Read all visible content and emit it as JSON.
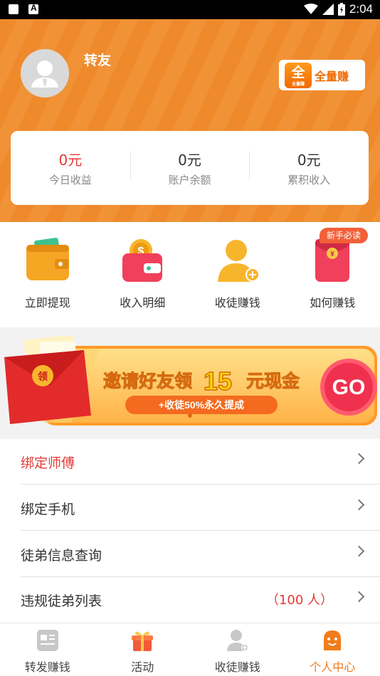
{
  "status_bar": {
    "time": "2:04"
  },
  "profile": {
    "username": "转友"
  },
  "brand_button": {
    "logo_char": "全",
    "logo_sub": "全量赚",
    "label": "全量赚"
  },
  "earnings": [
    {
      "value": "0元",
      "label": "今日收益",
      "highlight": true
    },
    {
      "value": "0元",
      "label": "账户余额",
      "highlight": false
    },
    {
      "value": "0元",
      "label": "累积收入",
      "highlight": false
    }
  ],
  "quick_actions": [
    {
      "label": "立即提现",
      "icon": "wallet-icon"
    },
    {
      "label": "收入明细",
      "icon": "coin-purse-icon"
    },
    {
      "label": "收徒赚钱",
      "icon": "add-user-icon"
    },
    {
      "label": "如何赚钱",
      "icon": "red-envelope-icon"
    }
  ],
  "new_user_badge": "新手必读",
  "banner": {
    "envelope_char": "领",
    "title_pre": "邀请好友领",
    "title_num": "15",
    "title_post": "元现金",
    "subtitle": "+收徒50%永久提成",
    "go_label": "GO"
  },
  "menu": [
    {
      "label": "绑定师傅",
      "red": true,
      "extra": ""
    },
    {
      "label": "绑定手机",
      "red": false,
      "extra": ""
    },
    {
      "label": "徒弟信息查询",
      "red": false,
      "extra": ""
    },
    {
      "label": "违规徒弟列表",
      "red": false,
      "extra": "（100 人）"
    }
  ],
  "tabs": [
    {
      "label": "转发赚钱",
      "icon": "news-icon",
      "active": false
    },
    {
      "label": "活动",
      "icon": "gift-icon",
      "active": false
    },
    {
      "label": "收徒赚钱",
      "icon": "user-add-icon",
      "active": false
    },
    {
      "label": "个人中心",
      "icon": "smiley-icon",
      "active": true
    }
  ],
  "colors": {
    "brand_orange": "#ef8a2c",
    "accent_red": "#e53935",
    "active_tab": "#f07c1c"
  }
}
